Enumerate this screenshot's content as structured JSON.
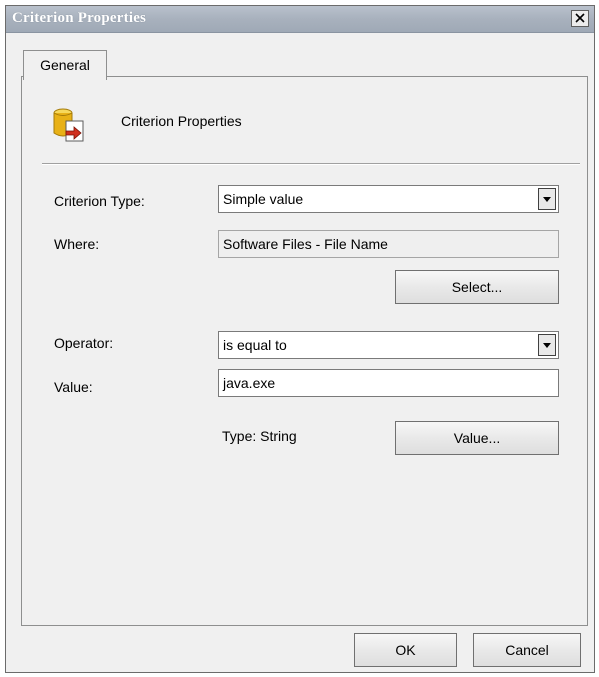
{
  "window": {
    "title": "Criterion Properties",
    "close_glyph": "×"
  },
  "tabs": [
    {
      "label": "General",
      "active": true
    }
  ],
  "header": {
    "icon": "criterion-properties-icon",
    "title": "Criterion Properties"
  },
  "form": {
    "criterion_type": {
      "label": "Criterion Type:",
      "value": "Simple value"
    },
    "where": {
      "label": "Where:",
      "value": "Software Files - File Name"
    },
    "select_button": "Select...",
    "operator": {
      "label": "Operator:",
      "value": "is equal to"
    },
    "value": {
      "label": "Value:",
      "value": "java.exe"
    },
    "type_text": "Type: String",
    "value_button": "Value..."
  },
  "footer": {
    "ok_label": "OK",
    "cancel_label": "Cancel"
  },
  "colors": {
    "titlebar": "#a8b1bd",
    "dialog_bg": "#f0f0f0",
    "icon_yellow": "#e8b117",
    "icon_red": "#d0301e"
  }
}
